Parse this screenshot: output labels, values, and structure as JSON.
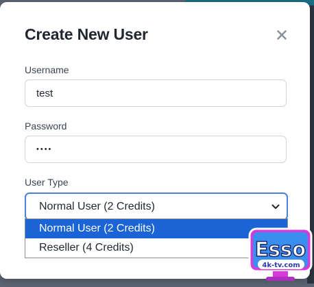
{
  "modal": {
    "title": "Create New User",
    "close_icon": "close-icon"
  },
  "fields": {
    "username": {
      "label": "Username",
      "value": "test"
    },
    "password": {
      "label": "Password",
      "value": "••••"
    },
    "user_type": {
      "label": "User Type",
      "selected": "Normal User (2 Credits)",
      "options": [
        {
          "label": "Normal User (2 Credits)",
          "highlighted": true
        },
        {
          "label": "Reseller (4 Credits)",
          "highlighted": false
        }
      ]
    }
  },
  "watermark": {
    "brand": "Esso",
    "domain": "4k-tv.com"
  },
  "colors": {
    "accent": "#4a7fd8",
    "highlight": "#1a64d6",
    "title": "#1f2630"
  }
}
